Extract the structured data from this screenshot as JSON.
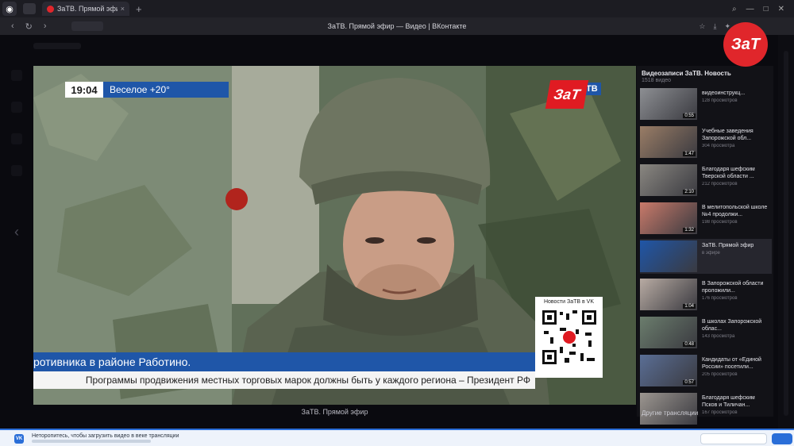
{
  "browser": {
    "tab_label": "ЗаТВ. Прямой эфир",
    "tab_close": "×",
    "new_tab": "+",
    "page_title": "ЗаТВ. Прямой эфир — Видео | ВКонтакте"
  },
  "player": {
    "time": "19:04",
    "weather": "Веселое +20°",
    "logo_za": "ЗаТ",
    "logo_tv": "ТВ",
    "ticker_top": "ротивника в районе Работино.",
    "ticker_bottom": "Программы продвижения местных торговых марок должны быть у каждого региона – Президент РФ",
    "qr_caption": "Новости ЗаТВ в VK",
    "caption": "ЗаТВ. Прямой эфир"
  },
  "playlist": {
    "title": "Видеозаписи ЗаТВ. Новость",
    "count": "1518 видео",
    "more": "Другие трансляции",
    "items": [
      {
        "title": "видеоинструкц...",
        "meta": "128 просмотров",
        "dur": "0:55",
        "color": "#8d8f93"
      },
      {
        "title": "Учебные заведения Запорожской обл...",
        "meta": "304 просмотра",
        "dur": "1:47",
        "color": "#9a7d66"
      },
      {
        "title": "Благодаря шефским Тверской области ...",
        "meta": "212 просмотров",
        "dur": "2:10",
        "color": "#8a8781"
      },
      {
        "title": "В мелитопольской школе №4 продолжи...",
        "meta": "198 просмотров",
        "dur": "1:32",
        "color": "#c97a6a"
      },
      {
        "title": "ЗаТВ. Прямой эфир",
        "meta": "в эфире",
        "dur": "",
        "color": "#1f56a8"
      },
      {
        "title": "В Запорожской области проложили...",
        "meta": "176 просмотров",
        "dur": "1:04",
        "color": "#b8aba3"
      },
      {
        "title": "В школах Запорожской облас...",
        "meta": "143 просмотра",
        "dur": "0:48",
        "color": "#6b7d6d"
      },
      {
        "title": "Кандидаты от «Единой России» посетили...",
        "meta": "205 просмотров",
        "dur": "0:57",
        "color": "#5a6e95"
      },
      {
        "title": "Благодаря шефским Псков и Тиличан...",
        "meta": "167 просмотров",
        "dur": "",
        "color": "#9c9690"
      }
    ]
  },
  "channel_logo": "ЗаТ",
  "notification": {
    "text": "Неторопитесь, чтобы загрузить видео в веке трансляции",
    "vk": "VK"
  },
  "colors": {
    "accent_blue": "#1f56a8",
    "brand_red": "#e01b22"
  }
}
